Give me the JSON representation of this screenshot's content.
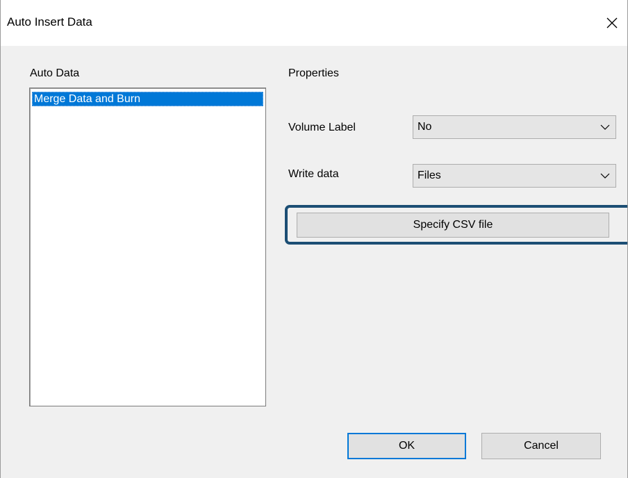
{
  "window": {
    "title": "Auto Insert Data",
    "close_glyph": "✕"
  },
  "auto_data": {
    "label": "Auto Data",
    "items": [
      "Merge Data and Burn"
    ],
    "selected_index": 0
  },
  "properties": {
    "heading": "Properties",
    "volume_label": {
      "label": "Volume Label",
      "value": "No"
    },
    "write_data": {
      "label": "Write data",
      "value": "Files"
    },
    "specify_csv_label": "Specify CSV file"
  },
  "footer": {
    "ok_label": "OK",
    "cancel_label": "Cancel"
  },
  "colors": {
    "selection": "#0078d7",
    "highlight_frame": "#1c4e74",
    "dialog_background": "#f0f0f0"
  }
}
